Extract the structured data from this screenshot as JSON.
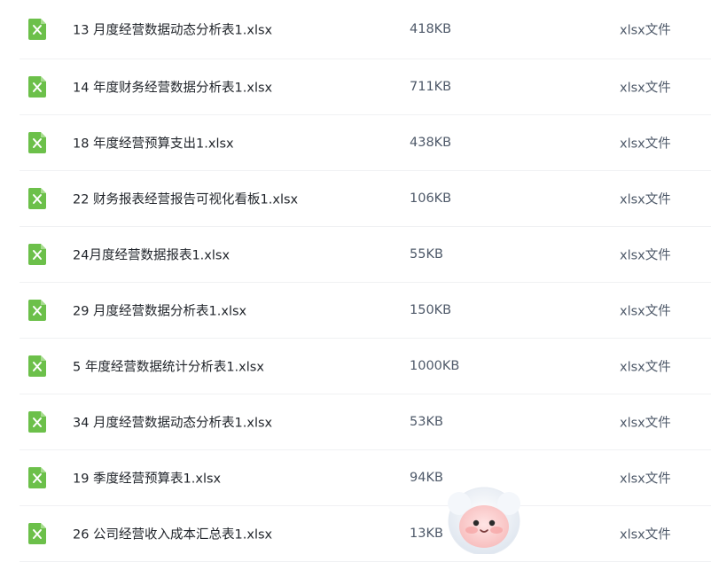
{
  "files": [
    {
      "name": "13 月度经营数据动态分析表1.xlsx",
      "size": "418KB",
      "type": "xlsx文件",
      "icon": "excel-file-icon"
    },
    {
      "name": "14 年度财务经营数据分析表1.xlsx",
      "size": "711KB",
      "type": "xlsx文件",
      "icon": "excel-file-icon"
    },
    {
      "name": "18 年度经营预算支出1.xlsx",
      "size": "438KB",
      "type": "xlsx文件",
      "icon": "excel-file-icon"
    },
    {
      "name": "22  财务报表经营报告可视化看板1.xlsx",
      "size": "106KB",
      "type": "xlsx文件",
      "icon": "excel-file-icon"
    },
    {
      "name": "24月度经营数据报表1.xlsx",
      "size": "55KB",
      "type": "xlsx文件",
      "icon": "excel-file-icon"
    },
    {
      "name": "29 月度经营数据分析表1.xlsx",
      "size": "150KB",
      "type": "xlsx文件",
      "icon": "excel-file-icon"
    },
    {
      "name": "5 年度经营数据统计分析表1.xlsx",
      "size": "1000KB",
      "type": "xlsx文件",
      "icon": "excel-file-icon"
    },
    {
      "name": "34 月度经营数据动态分析表1.xlsx",
      "size": "53KB",
      "type": "xlsx文件",
      "icon": "excel-file-icon"
    },
    {
      "name": "19 季度经营预算表1.xlsx",
      "size": "94KB",
      "type": "xlsx文件",
      "icon": "excel-file-icon"
    },
    {
      "name": "26 公司经营收入成本汇总表1.xlsx",
      "size": "13KB",
      "type": "xlsx文件",
      "icon": "excel-file-icon"
    }
  ],
  "colors": {
    "icon_green": "#6cc04a",
    "text_primary": "#1f2329",
    "text_secondary": "#4e5969"
  },
  "mascot": {
    "icon": "mascot-avatar-icon"
  }
}
